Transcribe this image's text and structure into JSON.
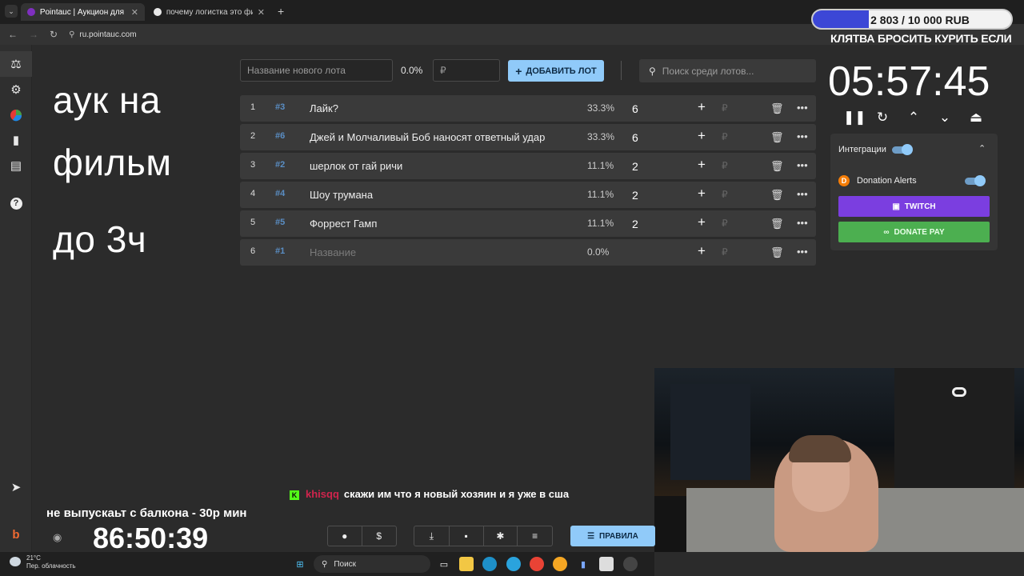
{
  "browser": {
    "tabs": [
      {
        "title": "Pointauc | Аукцион для стрим"
      },
      {
        "title": "почему логистка это фильм"
      }
    ],
    "url": "ru.pointauc.com"
  },
  "overlay": {
    "big_text": [
      "аук на",
      "фильм",
      "до 3ч"
    ],
    "donation_goal": {
      "text": "2 803 / 10 000 RUB",
      "progress": 0.2803
    },
    "vow": "КЛЯТВА БРОСИТЬ КУРИТЬ ЕСЛИ",
    "balcony": "не выпускаьт с балкона - 30р мин",
    "balcony_timer": "86:50:39",
    "chat": {
      "user": "khisqq",
      "message": "скажи им что я новый хозяин и я уже в сша"
    }
  },
  "controls": {
    "new_lot_placeholder": "Название нового лота",
    "percent": "0.0%",
    "amount_placeholder": "₽",
    "add_label": "ДОБАВИТЬ ЛОТ",
    "search_placeholder": "Поиск среди лотов..."
  },
  "lots": [
    {
      "num": "1",
      "id": "#3",
      "name": "Лайк?",
      "pct": "33.3%",
      "amount": "6"
    },
    {
      "num": "2",
      "id": "#6",
      "name": "Джей и Молчаливый Боб наносят ответный удар",
      "pct": "33.3%",
      "amount": "6"
    },
    {
      "num": "3",
      "id": "#2",
      "name": "шерлок от гай ричи",
      "pct": "11.1%",
      "amount": "2"
    },
    {
      "num": "4",
      "id": "#4",
      "name": "Шоу трумана",
      "pct": "11.1%",
      "amount": "2"
    },
    {
      "num": "5",
      "id": "#5",
      "name": "Форрест Гамп",
      "pct": "11.1%",
      "amount": "2"
    },
    {
      "num": "6",
      "id": "#1",
      "name": "Название",
      "pct": "0.0%",
      "amount": ""
    }
  ],
  "timer": {
    "value": "05:57:45"
  },
  "integrations": {
    "title": "Интеграции",
    "donation_alerts": "Donation Alerts",
    "twitch": "TWITCH",
    "donatepay": "DONATE PAY"
  },
  "bottom": {
    "rules_label": "ПРАВИЛА"
  },
  "taskbar": {
    "temp": "21°C",
    "weather": "Пер. облачность",
    "search": "Поиск"
  },
  "colors": {
    "accent": "#90caf9",
    "twitch": "#7b3ee0",
    "donatepay": "#4caf50",
    "lot_id": "#5a8ec4"
  }
}
